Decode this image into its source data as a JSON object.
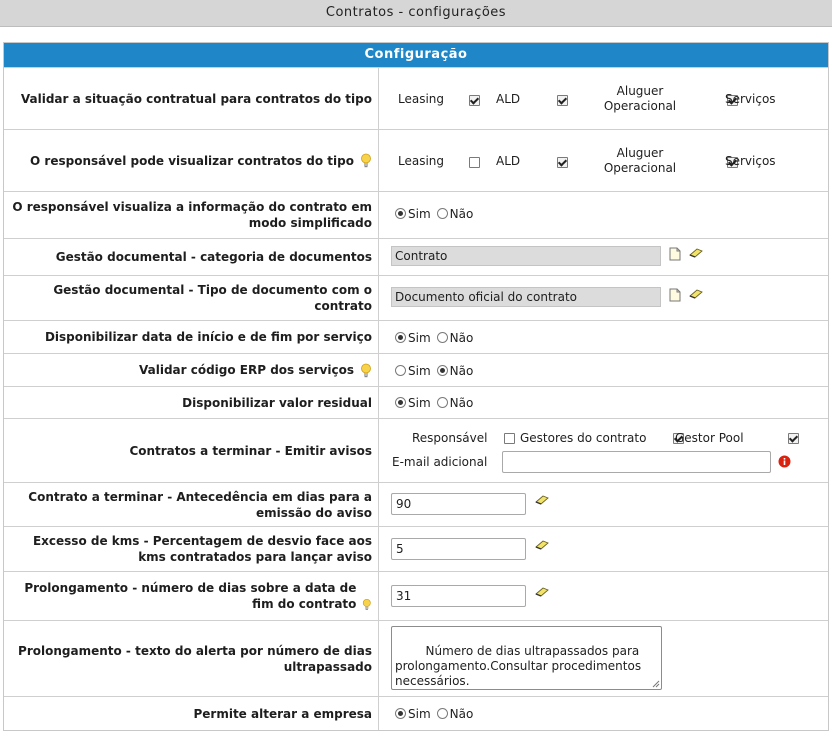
{
  "title": "Contratos - configurações",
  "panel": {
    "header": "Configuração"
  },
  "rows": {
    "validar": {
      "label": "Validar a situação contratual para contratos do tipo",
      "options": [
        {
          "label": "Leasing",
          "checked": true
        },
        {
          "label": "ALD",
          "checked": true
        },
        {
          "label": "Aluguer Operacional",
          "checked": true
        },
        {
          "label": "Serviços",
          "checked": false
        }
      ]
    },
    "responsavel_visualizar": {
      "label": "O responsável pode visualizar contratos do tipo",
      "options": [
        {
          "label": "Leasing",
          "checked": false
        },
        {
          "label": "ALD",
          "checked": true
        },
        {
          "label": "Aluguer Operacional",
          "checked": true
        },
        {
          "label": "Serviços",
          "checked": false
        }
      ]
    },
    "modo_simplificado": {
      "label": "O responsável visualiza a informação do contrato em modo simplificado",
      "selected": "Sim"
    },
    "categoria_documentos": {
      "label": "Gestão documental - categoria de documentos",
      "value": "Contrato"
    },
    "tipo_documento": {
      "label": "Gestão documental - Tipo de documento com o contrato",
      "value": "Documento oficial do contrato"
    },
    "data_inicio_fim": {
      "label": "Disponibilizar data de início e de fim por serviço",
      "selected": "Sim"
    },
    "codigo_erp": {
      "label": "Validar código ERP dos serviços",
      "selected": "Não"
    },
    "valor_residual": {
      "label": "Disponibilizar valor residual",
      "selected": "Sim"
    },
    "avisos": {
      "label": "Contratos a terminar - Emitir avisos",
      "responsavel_label": "Responsável",
      "responsavel_checked": false,
      "gestores_label": "Gestores do contrato",
      "gestores_checked": true,
      "gestor_pool_label": "Gestor Pool",
      "gestor_pool_checked": true,
      "email_label": "E-mail adicional",
      "email_value": ""
    },
    "antecedencia": {
      "label": "Contrato a terminar - Antecedência em dias para a emissão do aviso",
      "value": "90"
    },
    "excesso_kms": {
      "label": "Excesso de kms - Percentagem de desvio face aos kms contratados para lançar aviso",
      "value": "5"
    },
    "prolongamento_dias": {
      "label": "Prolongamento - número de dias sobre a data de fim do contrato",
      "value": "31"
    },
    "prolongamento_texto": {
      "label": "Prolongamento - texto do alerta por número de dias ultrapassado",
      "value": "Número de dias ultrapassados para prolongamento.Consultar procedimentos necessários."
    },
    "alterar_empresa": {
      "label": "Permite alterar a empresa",
      "selected": "Sim"
    }
  },
  "radio_labels": {
    "yes": "Sim",
    "no": "Não"
  },
  "icons": {
    "tip": "lightbulb-icon",
    "edit": "eraser-pencil-icon",
    "doc": "document-icon",
    "info": "info-icon"
  },
  "colors": {
    "header": "#1f86c8",
    "titlebar": "#d6d6d6",
    "info": "#d9230f"
  }
}
